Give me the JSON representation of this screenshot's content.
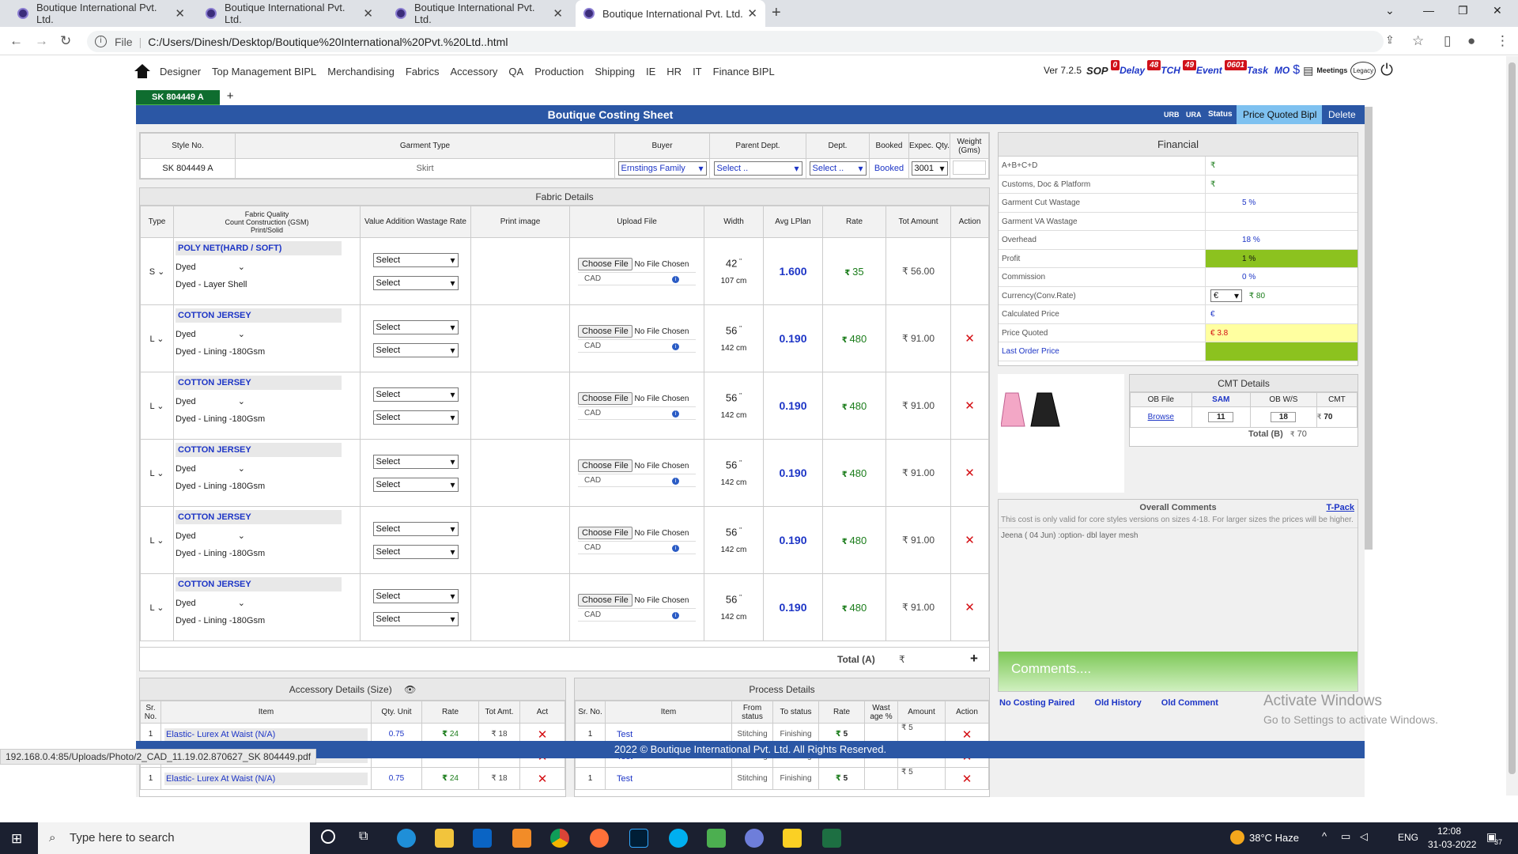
{
  "browser": {
    "tabs": [
      {
        "title": "Boutique International Pvt. Ltd."
      },
      {
        "title": "Boutique International Pvt. Ltd."
      },
      {
        "title": "Boutique International Pvt. Ltd."
      },
      {
        "title": "Boutique International Pvt. Ltd."
      }
    ],
    "url_scheme": "File",
    "url": "C:/Users/Dinesh/Desktop/Boutique%20International%20Pvt.%20Ltd..html",
    "new_tab": "+"
  },
  "nav": {
    "items": [
      "Designer",
      "Top Management BIPL",
      "Merchandising",
      "Fabrics",
      "Accessory",
      "QA",
      "Production",
      "Shipping",
      "IE",
      "HR",
      "IT",
      "Finance BIPL"
    ],
    "version": "Ver 7.2.5",
    "sop": "SOP",
    "delay_badge": "0",
    "delay_label": "Delay",
    "tch_badge": "48",
    "tch_label": "TCH",
    "event_badge": "49",
    "task_badge": "0601",
    "event_label": "Event",
    "task_label": "Task",
    "mo_label": "MO",
    "meetings_label": "Meetings",
    "legacy_label": "Legacy"
  },
  "style_chip": "SK 804449 A",
  "add_style": "+",
  "header": {
    "title": "Boutique Costing Sheet",
    "urb": "URB",
    "ura": "URA",
    "status": "Status",
    "price_quoted": "Price Quoted Bipl",
    "delete": "Delete"
  },
  "info_table": {
    "headers": [
      "Style No.",
      "Garment Type",
      "Buyer",
      "Parent Dept.",
      "Dept.",
      "Booked",
      "Expec. Qty.",
      "Weight (Gms)"
    ],
    "style_no": "SK 804449 A",
    "garment_type": "Skirt",
    "buyer": "Ernstings Family",
    "parent_dept": "Select ..",
    "dept": "Select ..",
    "booked": "Booked",
    "qty": "3001"
  },
  "fabric": {
    "caption": "Fabric Details",
    "headers": [
      "Type",
      "Fabric Quality\nCount Construction (GSM)\nPrint/Solid",
      "Value Addition Wastage Rate",
      "Print image",
      "Upload File",
      "Width",
      "Avg LPlan",
      "Rate",
      "Tot Amount",
      "Action"
    ],
    "rows": [
      {
        "type": "S",
        "quality": "POLY NET(HARD / SOFT)",
        "dye": "Dyed",
        "desc": "Dyed - Layer Shell",
        "va1": "Select",
        "va2": "Select",
        "choose": "Choose File",
        "nofile": "No File Chosen",
        "cad": "CAD",
        "width_in": "42",
        "width_cm": "107 cm",
        "lplan": "1.600",
        "rate": "35",
        "amount": "₹ 56.00",
        "rupee": "₹",
        "inch": "\"",
        "del": ""
      },
      {
        "type": "L",
        "quality": "COTTON JERSEY",
        "dye": "Dyed",
        "desc": "Dyed - Lining -180Gsm",
        "va1": "Select",
        "va2": "Select",
        "choose": "Choose File",
        "nofile": "No File Chosen",
        "cad": "CAD",
        "width_in": "56",
        "width_cm": "142 cm",
        "lplan": "0.190",
        "rate": "480",
        "amount": "₹ 91.00",
        "rupee": "₹",
        "inch": "\"",
        "del": "✕"
      },
      {
        "type": "L",
        "quality": "COTTON JERSEY",
        "dye": "Dyed",
        "desc": "Dyed - Lining -180Gsm",
        "va1": "Select",
        "va2": "Select",
        "choose": "Choose File",
        "nofile": "No File Chosen",
        "cad": "CAD",
        "width_in": "56",
        "width_cm": "142 cm",
        "lplan": "0.190",
        "rate": "480",
        "amount": "₹ 91.00",
        "rupee": "₹",
        "inch": "\"",
        "del": "✕"
      },
      {
        "type": "L",
        "quality": "COTTON JERSEY",
        "dye": "Dyed",
        "desc": "Dyed - Lining -180Gsm",
        "va1": "Select",
        "va2": "Select",
        "choose": "Choose File",
        "nofile": "No File Chosen",
        "cad": "CAD",
        "width_in": "56",
        "width_cm": "142 cm",
        "lplan": "0.190",
        "rate": "480",
        "amount": "₹ 91.00",
        "rupee": "₹",
        "inch": "\"",
        "del": "✕"
      },
      {
        "type": "L",
        "quality": "COTTON JERSEY",
        "dye": "Dyed",
        "desc": "Dyed - Lining -180Gsm",
        "va1": "Select",
        "va2": "Select",
        "choose": "Choose File",
        "nofile": "No File Chosen",
        "cad": "CAD",
        "width_in": "56",
        "width_cm": "142 cm",
        "lplan": "0.190",
        "rate": "480",
        "amount": "₹ 91.00",
        "rupee": "₹",
        "inch": "\"",
        "del": "✕"
      },
      {
        "type": "L",
        "quality": "COTTON JERSEY",
        "dye": "Dyed",
        "desc": "Dyed - Lining -180Gsm",
        "va1": "Select",
        "va2": "Select",
        "choose": "Choose File",
        "nofile": "No File Chosen",
        "cad": "CAD",
        "width_in": "56",
        "width_cm": "142 cm",
        "lplan": "0.190",
        "rate": "480",
        "amount": "₹ 91.00",
        "rupee": "₹",
        "inch": "\"",
        "del": "✕"
      }
    ],
    "total_label": "Total (A)",
    "total_rupee": "₹",
    "add": "+"
  },
  "financial": {
    "caption": "Financial",
    "rows": [
      {
        "label": "A+B+C+D",
        "value": "₹"
      },
      {
        "label": "Customs, Doc & Platform",
        "value": "₹"
      },
      {
        "label": "Garment Cut Wastage",
        "value": "5 %"
      },
      {
        "label": "Garment VA Wastage",
        "value": ""
      },
      {
        "label": "Overhead",
        "value": "18 %"
      },
      {
        "label": "Profit",
        "value": "1 %"
      },
      {
        "label": "Commission",
        "value": "0 %"
      },
      {
        "label": "Currency(Conv.Rate)",
        "value": "₹ 80"
      },
      {
        "label": "Calculated Price",
        "value": "€"
      },
      {
        "label": "Price Quoted",
        "value": "€ 3.8"
      },
      {
        "label": "Last Order Price",
        "value": ""
      }
    ],
    "currency_select": "€",
    "colors": {
      "profit_bg": "#8cc21f",
      "quoted_bg": "#ffffa0",
      "last_bg": "#8cc21f"
    }
  },
  "cmt": {
    "caption": "CMT Details",
    "headers": [
      "OB File",
      "SAM",
      "OB W/S",
      "CMT"
    ],
    "browse": "Browse",
    "sam": "11",
    "obws": "18",
    "rupee": "₹",
    "cmt": "70",
    "total_label": "Total (B)",
    "total_value": "70"
  },
  "comments": {
    "caption": "Overall Comments",
    "tpack": "T-Pack",
    "note": "This cost is only valid for core styles versions on sizes 4-18. For larger sizes the prices will be higher.",
    "entry": "Jeena ( 04 Jun) :option- dbl layer mesh",
    "placeholder": "Comments....",
    "links": [
      "No Costing Paired",
      "Old History",
      "Old Comment"
    ]
  },
  "accessory": {
    "caption": "Accessory Details (Size)",
    "headers": [
      "Sr. No.",
      "Item",
      "Qty. Unit",
      "Rate",
      "Tot Amt.",
      "Act"
    ],
    "rows": [
      {
        "sr": "1",
        "item": "Elastic- Lurex At Waist (N/A)",
        "qty": "0.75",
        "rate": "24",
        "amt": "₹ 18",
        "rupee": "₹",
        "del": "✕"
      },
      {
        "sr": "1",
        "item": "Elastic- Lurex At Waist (N/A)",
        "qty": "0.75",
        "rate": "24",
        "amt": "₹ 18",
        "rupee": "₹",
        "del": "✕"
      },
      {
        "sr": "1",
        "item": "Elastic- Lurex At Waist (N/A)",
        "qty": "0.75",
        "rate": "24",
        "amt": "₹ 18",
        "rupee": "₹",
        "del": "✕"
      }
    ]
  },
  "process": {
    "caption": "Process Details",
    "headers": [
      "Sr. No.",
      "Item",
      "From status",
      "To status",
      "Rate",
      "Wast age %",
      "Amount",
      "Action"
    ],
    "rows": [
      {
        "sr": "1",
        "item": "Test",
        "from": "Stitching",
        "to": "Finishing",
        "rate": "5",
        "amt": "₹ 5",
        "rupee": "₹",
        "del": "✕"
      },
      {
        "sr": "1",
        "item": "Test",
        "from": "Stitching",
        "to": "Finishing",
        "rate": "5",
        "amt": "₹ 5",
        "rupee": "₹",
        "del": "✕"
      },
      {
        "sr": "1",
        "item": "Test",
        "from": "Stitching",
        "to": "Finishing",
        "rate": "5",
        "amt": "₹ 5",
        "rupee": "₹",
        "del": "✕"
      }
    ]
  },
  "footer": "2022 © Boutique International Pvt. Ltd. All Rights Reserved.",
  "status_url": "192.168.0.4:85/Uploads/Photo/2_CAD_11.19.02.870627_SK 804449.pdf",
  "activate": {
    "line1": "Activate Windows",
    "line2": "Go to Settings to activate Windows."
  },
  "taskbar": {
    "search": "Type here to search",
    "weather": "38°C  Haze",
    "lang": "ENG",
    "time": "12:08",
    "date": "31-03-2022",
    "notif": "37"
  }
}
